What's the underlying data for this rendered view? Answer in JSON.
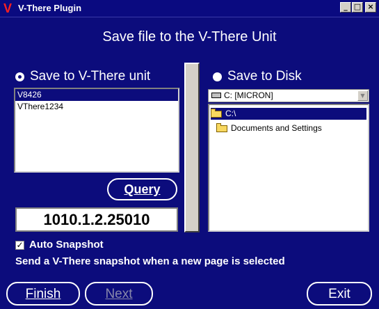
{
  "window": {
    "title": "V-There Plugin",
    "logo": "V",
    "controls": {
      "minimize": "_",
      "maximize": "□",
      "close": "×"
    }
  },
  "heading": "Save file to the V-There Unit",
  "left_panel": {
    "radio_label": "Save to V-There unit",
    "radio_checked": true,
    "units": [
      {
        "label": "V8426",
        "selected": true
      },
      {
        "label": "VThere1234",
        "selected": false
      }
    ],
    "query_label": "Query",
    "ip_value": "1010.1.2.25010"
  },
  "right_panel": {
    "radio_label": "Save to Disk",
    "radio_checked": false,
    "drive_value": "C: [MICRON]",
    "folders": [
      {
        "label": "C:\\",
        "selected": true
      },
      {
        "label": "Documents and Settings",
        "selected": false
      }
    ]
  },
  "auto_snapshot": {
    "label": "Auto Snapshot",
    "checked": true,
    "check_glyph": "✓"
  },
  "info_text": "Send a V-There snapshot when a new page is selected",
  "buttons": {
    "finish": "Finish",
    "next": "Next",
    "exit": "Exit"
  },
  "colors": {
    "background": "#0c0c7c",
    "logo": "#ff2020",
    "selection": "#0c0c7c"
  }
}
